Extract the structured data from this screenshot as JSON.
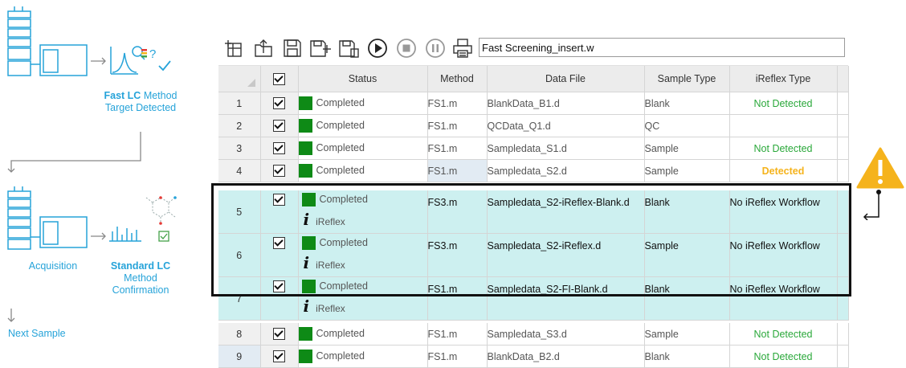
{
  "diagram": {
    "fast_lc_bold": "Fast LC",
    "fast_lc_rest": "Method",
    "target_detected": "Target Detected",
    "acquisition": "Acquisition",
    "standard_lc_bold": "Standard LC",
    "method": "Method",
    "confirmation": "Confirmation",
    "next_sample": "Next Sample",
    "question_mark": "?"
  },
  "toolbar": {
    "filename": "Fast Screening_insert.w",
    "icons": [
      "new-sequence-icon",
      "open-folder-icon",
      "save-icon",
      "save-plus-icon",
      "save-as-icon",
      "play-icon",
      "stop-icon",
      "pause-icon",
      "print-icon"
    ]
  },
  "table": {
    "headers": [
      "Status",
      "Method",
      "Data File",
      "Sample Type",
      "iReflex Type"
    ],
    "rows": [
      {
        "n": "1",
        "status": "Completed",
        "method": "FS1.m",
        "file": "BlankData_B1.d",
        "type": "Blank",
        "ireflex": "Not Detected"
      },
      {
        "n": "2",
        "status": "Completed",
        "method": "FS1.m",
        "file": "QCData_Q1.d",
        "type": "QC",
        "ireflex": ""
      },
      {
        "n": "3",
        "status": "Completed",
        "method": "FS1.m",
        "file": "Sampledata_S1.d",
        "type": "Sample",
        "ireflex": "Not Detected"
      },
      {
        "n": "4",
        "status": "Completed",
        "method": "FS1.m",
        "file": "Sampledata_S2.d",
        "type": "Sample",
        "ireflex": "Detected"
      },
      {
        "n": "5",
        "status": "Completed",
        "status2": "iReflex",
        "method": "FS3.m",
        "file": "Sampledata_S2-iReflex-Blank.d",
        "type": "Blank",
        "ireflex": "No iReflex Workflow"
      },
      {
        "n": "6",
        "status": "Completed",
        "status2": "iReflex",
        "method": "FS3.m",
        "file": "Sampledata_S2-iReflex.d",
        "type": "Sample",
        "ireflex": "No iReflex Workflow"
      },
      {
        "n": "7",
        "status": "Completed",
        "status2": "iReflex",
        "method": "FS1.m",
        "file": "Sampledata_S2-FI-Blank.d",
        "type": "Blank",
        "ireflex": "No iReflex Workflow"
      },
      {
        "n": "8",
        "status": "Completed",
        "method": "FS1.m",
        "file": "Sampledata_S3.d",
        "type": "Sample",
        "ireflex": "Not Detected"
      },
      {
        "n": "9",
        "status": "Completed",
        "method": "FS1.m",
        "file": "BlankData_B2.d",
        "type": "Blank",
        "ireflex": "Not Detected"
      }
    ],
    "info_glyph": "i"
  },
  "colors": {
    "accent_cyan": "#26a3d9",
    "completed_green": "#0e8a16",
    "not_detected": "#2aa83a",
    "detected": "#f5b31c",
    "ireflex_row": "#cdf0f0",
    "warning": "#f5b31c"
  }
}
